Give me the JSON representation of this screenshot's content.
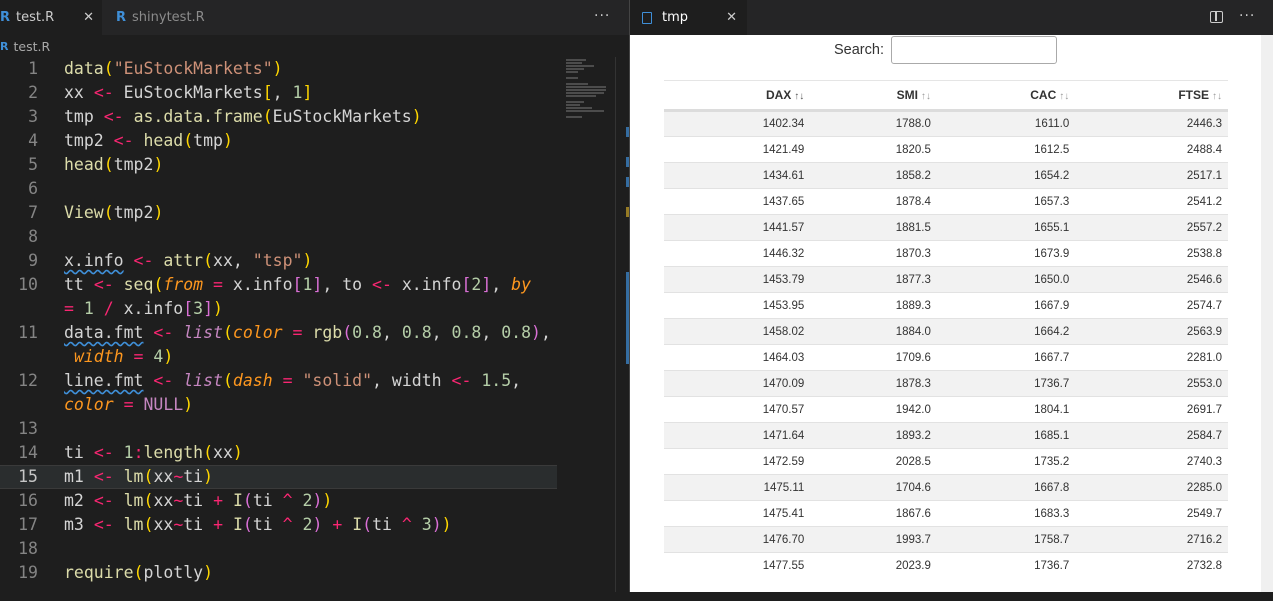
{
  "editor": {
    "tabs": [
      {
        "icon": "R",
        "label": "test.R",
        "close": "✕"
      },
      {
        "icon": "R",
        "label": "shinytest.R"
      }
    ],
    "more": "···",
    "breadcrumb": {
      "icon": "R",
      "file": "test.R"
    },
    "current_line": 15,
    "lines": [
      {
        "n": "1",
        "tokens": [
          [
            "fn",
            "data"
          ],
          [
            "br",
            "("
          ],
          [
            "str",
            "\"EuStockMarkets\""
          ],
          [
            "br",
            ")"
          ]
        ]
      },
      {
        "n": "2",
        "tokens": [
          [
            "txt",
            "xx "
          ],
          [
            "op",
            "<-"
          ],
          [
            "txt",
            " EuStockMarkets"
          ],
          [
            "br",
            "["
          ],
          [
            "txt",
            ", "
          ],
          [
            "num",
            "1"
          ],
          [
            "br",
            "]"
          ]
        ]
      },
      {
        "n": "3",
        "tokens": [
          [
            "txt",
            "tmp "
          ],
          [
            "op",
            "<-"
          ],
          [
            "txt",
            " "
          ],
          [
            "fn",
            "as.data.frame"
          ],
          [
            "br",
            "("
          ],
          [
            "txt",
            "EuStockMarkets"
          ],
          [
            "br",
            ")"
          ]
        ]
      },
      {
        "n": "4",
        "tokens": [
          [
            "txt",
            "tmp2 "
          ],
          [
            "op",
            "<-"
          ],
          [
            "txt",
            " "
          ],
          [
            "fn",
            "head"
          ],
          [
            "br",
            "("
          ],
          [
            "txt",
            "tmp"
          ],
          [
            "br",
            ")"
          ]
        ]
      },
      {
        "n": "5",
        "tokens": [
          [
            "fn",
            "head"
          ],
          [
            "br",
            "("
          ],
          [
            "txt",
            "tmp2"
          ],
          [
            "br",
            ")"
          ]
        ]
      },
      {
        "n": "6",
        "tokens": []
      },
      {
        "n": "7",
        "tokens": [
          [
            "fn",
            "View"
          ],
          [
            "br",
            "("
          ],
          [
            "txt",
            "tmp2"
          ],
          [
            "br",
            ")"
          ]
        ]
      },
      {
        "n": "8",
        "tokens": []
      },
      {
        "n": "9",
        "tokens": [
          [
            "wavy",
            "x.info"
          ],
          [
            "txt",
            " "
          ],
          [
            "op",
            "<-"
          ],
          [
            "txt",
            " "
          ],
          [
            "fn",
            "attr"
          ],
          [
            "br",
            "("
          ],
          [
            "txt",
            "xx, "
          ],
          [
            "str",
            "\"tsp\""
          ],
          [
            "br",
            ")"
          ]
        ]
      },
      {
        "n": "10",
        "tokens": [
          [
            "txt",
            "tt "
          ],
          [
            "op",
            "<-"
          ],
          [
            "txt",
            " "
          ],
          [
            "fn",
            "seq"
          ],
          [
            "br",
            "("
          ],
          [
            "arg",
            "from"
          ],
          [
            "op",
            " ="
          ],
          [
            "txt",
            " x.info"
          ],
          [
            "br2",
            "["
          ],
          [
            "num",
            "1"
          ],
          [
            "br2",
            "]"
          ],
          [
            "txt",
            ", to "
          ],
          [
            "op",
            "<-"
          ],
          [
            "txt",
            " x.info"
          ],
          [
            "br2",
            "["
          ],
          [
            "num",
            "2"
          ],
          [
            "br2",
            "]"
          ],
          [
            "txt",
            ", "
          ],
          [
            "arg",
            "by"
          ]
        ]
      },
      {
        "n": "",
        "tokens": [
          [
            "op",
            "= "
          ],
          [
            "num",
            "1"
          ],
          [
            "op",
            " /"
          ],
          [
            "txt",
            " x.info"
          ],
          [
            "br2",
            "["
          ],
          [
            "num",
            "3"
          ],
          [
            "br2",
            "]"
          ],
          [
            "br",
            ")"
          ]
        ]
      },
      {
        "n": "11",
        "tokens": [
          [
            "wavy",
            "data.fmt"
          ],
          [
            "txt",
            " "
          ],
          [
            "op",
            "<-"
          ],
          [
            "txt",
            " "
          ],
          [
            "list",
            "list"
          ],
          [
            "br",
            "("
          ],
          [
            "arg",
            "color"
          ],
          [
            "op",
            " ="
          ],
          [
            "txt",
            " "
          ],
          [
            "fn",
            "rgb"
          ],
          [
            "br2",
            "("
          ],
          [
            "num",
            "0.8"
          ],
          [
            "txt",
            ", "
          ],
          [
            "num",
            "0.8"
          ],
          [
            "txt",
            ", "
          ],
          [
            "num",
            "0.8"
          ],
          [
            "txt",
            ", "
          ],
          [
            "num",
            "0.8"
          ],
          [
            "br2",
            ")"
          ],
          [
            "txt",
            ","
          ]
        ]
      },
      {
        "n": "",
        "tokens": [
          [
            "txt",
            " "
          ],
          [
            "arg",
            "width"
          ],
          [
            "op",
            " ="
          ],
          [
            "txt",
            " "
          ],
          [
            "num",
            "4"
          ],
          [
            "br",
            ")"
          ]
        ]
      },
      {
        "n": "12",
        "tokens": [
          [
            "wavy",
            "line.fmt"
          ],
          [
            "txt",
            " "
          ],
          [
            "op",
            "<-"
          ],
          [
            "txt",
            " "
          ],
          [
            "list",
            "list"
          ],
          [
            "br",
            "("
          ],
          [
            "arg",
            "dash"
          ],
          [
            "op",
            " ="
          ],
          [
            "txt",
            " "
          ],
          [
            "str",
            "\"solid\""
          ],
          [
            "txt",
            ", width "
          ],
          [
            "op",
            "<-"
          ],
          [
            "txt",
            " "
          ],
          [
            "num",
            "1.5"
          ],
          [
            "txt",
            ","
          ]
        ]
      },
      {
        "n": "",
        "tokens": [
          [
            "arg",
            "color"
          ],
          [
            "op",
            " ="
          ],
          [
            "txt",
            " "
          ],
          [
            "kw",
            "NULL"
          ],
          [
            "br",
            ")"
          ]
        ]
      },
      {
        "n": "13",
        "tokens": []
      },
      {
        "n": "14",
        "tokens": [
          [
            "txt",
            "ti "
          ],
          [
            "op",
            "<-"
          ],
          [
            "txt",
            " "
          ],
          [
            "num",
            "1"
          ],
          [
            "op",
            ":"
          ],
          [
            "fn",
            "length"
          ],
          [
            "br",
            "("
          ],
          [
            "txt",
            "xx"
          ],
          [
            "br",
            ")"
          ]
        ]
      },
      {
        "n": "15",
        "tokens": [
          [
            "txt",
            "m1 "
          ],
          [
            "op",
            "<-"
          ],
          [
            "txt",
            " "
          ],
          [
            "fn",
            "lm"
          ],
          [
            "br",
            "("
          ],
          [
            "txt",
            "xx"
          ],
          [
            "op",
            "~"
          ],
          [
            "txt",
            "ti"
          ],
          [
            "br",
            ")"
          ]
        ]
      },
      {
        "n": "16",
        "tokens": [
          [
            "txt",
            "m2 "
          ],
          [
            "op",
            "<-"
          ],
          [
            "txt",
            " "
          ],
          [
            "fn",
            "lm"
          ],
          [
            "br",
            "("
          ],
          [
            "txt",
            "xx"
          ],
          [
            "op",
            "~"
          ],
          [
            "txt",
            "ti "
          ],
          [
            "op",
            "+"
          ],
          [
            "txt",
            " "
          ],
          [
            "fn",
            "I"
          ],
          [
            "br2",
            "("
          ],
          [
            "txt",
            "ti "
          ],
          [
            "op",
            "^"
          ],
          [
            "txt",
            " "
          ],
          [
            "num",
            "2"
          ],
          [
            "br2",
            ")"
          ],
          [
            "br",
            ")"
          ]
        ]
      },
      {
        "n": "17",
        "tokens": [
          [
            "txt",
            "m3 "
          ],
          [
            "op",
            "<-"
          ],
          [
            "txt",
            " "
          ],
          [
            "fn",
            "lm"
          ],
          [
            "br",
            "("
          ],
          [
            "txt",
            "xx"
          ],
          [
            "op",
            "~"
          ],
          [
            "txt",
            "ti "
          ],
          [
            "op",
            "+"
          ],
          [
            "txt",
            " "
          ],
          [
            "fn",
            "I"
          ],
          [
            "br2",
            "("
          ],
          [
            "txt",
            "ti "
          ],
          [
            "op",
            "^"
          ],
          [
            "txt",
            " "
          ],
          [
            "num",
            "2"
          ],
          [
            "br2",
            ")"
          ],
          [
            "txt",
            " "
          ],
          [
            "op",
            "+"
          ],
          [
            "txt",
            " "
          ],
          [
            "fn",
            "I"
          ],
          [
            "br2",
            "("
          ],
          [
            "txt",
            "ti "
          ],
          [
            "op",
            "^"
          ],
          [
            "txt",
            " "
          ],
          [
            "num",
            "3"
          ],
          [
            "br2",
            ")"
          ],
          [
            "br",
            ")"
          ]
        ]
      },
      {
        "n": "18",
        "tokens": []
      },
      {
        "n": "19",
        "tokens": [
          [
            "fn",
            "require"
          ],
          [
            "br",
            "("
          ],
          [
            "txt",
            "plotly"
          ],
          [
            "br",
            ")"
          ]
        ]
      }
    ]
  },
  "viewer": {
    "tab": {
      "label": "tmp",
      "close": "✕"
    },
    "more": "···",
    "search_label": "Search:",
    "search_value": "",
    "columns": [
      {
        "name": "DAX",
        "sort": "↑↓"
      },
      {
        "name": "SMI",
        "sort": "↑↓"
      },
      {
        "name": "CAC",
        "sort": "↑↓"
      },
      {
        "name": "FTSE",
        "sort": "↑↓"
      }
    ],
    "rows": [
      [
        "1402.34",
        "1788.0",
        "1611.0",
        "2446.3"
      ],
      [
        "1421.49",
        "1820.5",
        "1612.5",
        "2488.4"
      ],
      [
        "1434.61",
        "1858.2",
        "1654.2",
        "2517.1"
      ],
      [
        "1437.65",
        "1878.4",
        "1657.3",
        "2541.2"
      ],
      [
        "1441.57",
        "1881.5",
        "1655.1",
        "2557.2"
      ],
      [
        "1446.32",
        "1870.3",
        "1673.9",
        "2538.8"
      ],
      [
        "1453.79",
        "1877.3",
        "1650.0",
        "2546.6"
      ],
      [
        "1453.95",
        "1889.3",
        "1667.9",
        "2574.7"
      ],
      [
        "1458.02",
        "1884.0",
        "1664.2",
        "2563.9"
      ],
      [
        "1464.03",
        "1709.6",
        "1667.7",
        "2281.0"
      ],
      [
        "1470.09",
        "1878.3",
        "1736.7",
        "2553.0"
      ],
      [
        "1470.57",
        "1942.0",
        "1804.1",
        "2691.7"
      ],
      [
        "1471.64",
        "1893.2",
        "1685.1",
        "2584.7"
      ],
      [
        "1472.59",
        "2028.5",
        "1735.2",
        "2740.3"
      ],
      [
        "1475.11",
        "1704.6",
        "1667.8",
        "2285.0"
      ],
      [
        "1475.41",
        "1867.6",
        "1683.3",
        "2549.7"
      ],
      [
        "1476.70",
        "1993.7",
        "1758.7",
        "2716.2"
      ],
      [
        "1477.55",
        "2023.9",
        "1736.7",
        "2732.8"
      ]
    ]
  }
}
